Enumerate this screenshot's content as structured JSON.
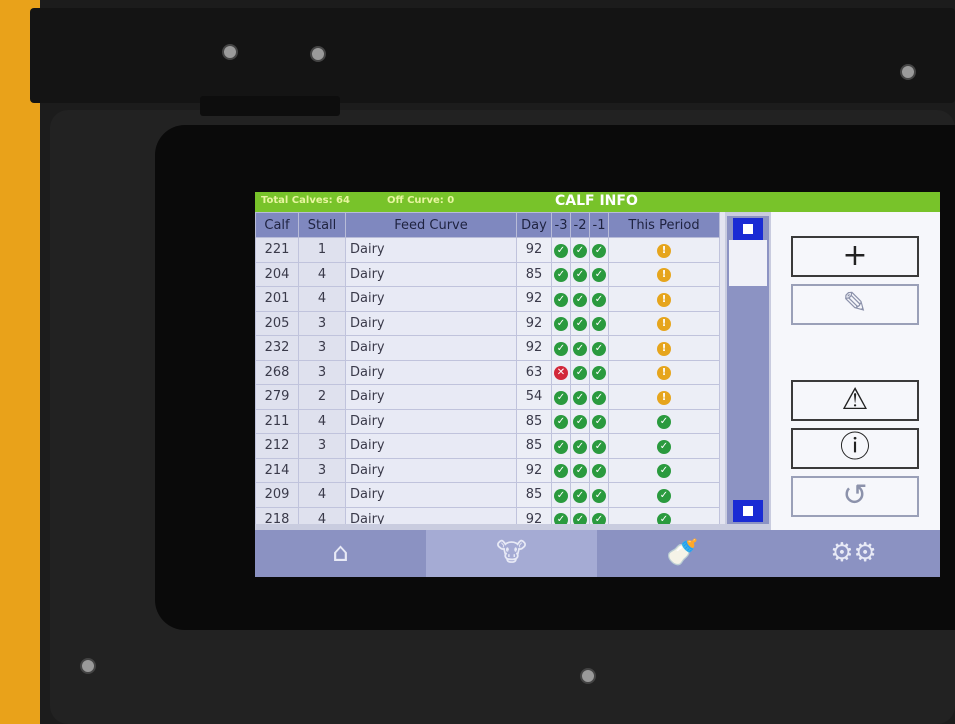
{
  "header": {
    "total_calves": "Total Calves: 64",
    "off_curve": "Off Curve: 0",
    "title": "CALF INFO"
  },
  "columns": [
    "Calf",
    "Stall",
    "Feed Curve",
    "Day",
    "-3",
    "-2",
    "-1",
    "This Period"
  ],
  "rows": [
    {
      "calf": "221",
      "stall": "1",
      "feed": "Dairy",
      "day": "92",
      "d3": "ok",
      "d2": "ok",
      "d1": "ok",
      "period": "warn"
    },
    {
      "calf": "204",
      "stall": "4",
      "feed": "Dairy",
      "day": "85",
      "d3": "ok",
      "d2": "ok",
      "d1": "ok",
      "period": "warn"
    },
    {
      "calf": "201",
      "stall": "4",
      "feed": "Dairy",
      "day": "92",
      "d3": "ok",
      "d2": "ok",
      "d1": "ok",
      "period": "warn"
    },
    {
      "calf": "205",
      "stall": "3",
      "feed": "Dairy",
      "day": "92",
      "d3": "ok",
      "d2": "ok",
      "d1": "ok",
      "period": "warn"
    },
    {
      "calf": "232",
      "stall": "3",
      "feed": "Dairy",
      "day": "92",
      "d3": "ok",
      "d2": "ok",
      "d1": "ok",
      "period": "warn"
    },
    {
      "calf": "268",
      "stall": "3",
      "feed": "Dairy",
      "day": "63",
      "d3": "bad",
      "d2": "ok",
      "d1": "ok",
      "period": "warn"
    },
    {
      "calf": "279",
      "stall": "2",
      "feed": "Dairy",
      "day": "54",
      "d3": "ok",
      "d2": "ok",
      "d1": "ok",
      "period": "warn"
    },
    {
      "calf": "211",
      "stall": "4",
      "feed": "Dairy",
      "day": "85",
      "d3": "ok",
      "d2": "ok",
      "d1": "ok",
      "period": "ok"
    },
    {
      "calf": "212",
      "stall": "3",
      "feed": "Dairy",
      "day": "85",
      "d3": "ok",
      "d2": "ok",
      "d1": "ok",
      "period": "ok"
    },
    {
      "calf": "214",
      "stall": "3",
      "feed": "Dairy",
      "day": "92",
      "d3": "ok",
      "d2": "ok",
      "d1": "ok",
      "period": "ok"
    },
    {
      "calf": "209",
      "stall": "4",
      "feed": "Dairy",
      "day": "85",
      "d3": "ok",
      "d2": "ok",
      "d1": "ok",
      "period": "ok"
    },
    {
      "calf": "218",
      "stall": "4",
      "feed": "Dairy",
      "day": "92",
      "d3": "ok",
      "d2": "ok",
      "d1": "ok",
      "period": "ok"
    }
  ],
  "side_buttons": [
    {
      "name": "add-button",
      "icon": "plus-icon",
      "glyph": "+",
      "enabled": true
    },
    {
      "name": "edit-button",
      "icon": "pencil-icon",
      "glyph": "✎",
      "enabled": false
    },
    {
      "name": "alert-button",
      "icon": "warning-icon",
      "glyph": "⚠",
      "enabled": true
    },
    {
      "name": "info-button",
      "icon": "info-icon",
      "glyph": "ⓘ",
      "enabled": true
    },
    {
      "name": "history-button",
      "icon": "history-icon",
      "glyph": "↺",
      "enabled": false
    }
  ],
  "nav": [
    {
      "name": "nav-home",
      "icon": "home-icon",
      "glyph": "⌂",
      "active": false
    },
    {
      "name": "nav-calves",
      "icon": "calf-head-icon",
      "glyph": "🐮",
      "active": true
    },
    {
      "name": "nav-bottle",
      "icon": "bottle-icon",
      "glyph": "🍼",
      "active": false
    },
    {
      "name": "nav-settings",
      "icon": "gears-icon",
      "glyph": "⚙⚙",
      "active": false
    }
  ],
  "colors": {
    "header_green": "#78c32a",
    "accent_blue": "#1a2bd4",
    "ok": "#2a9a3e",
    "bad": "#d2283a",
    "warn": "#e6a51d"
  }
}
